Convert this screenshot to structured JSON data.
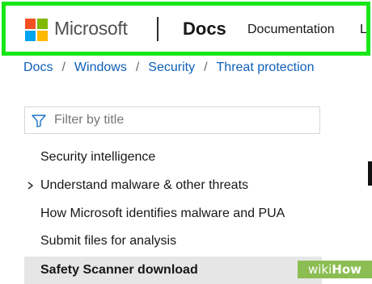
{
  "header": {
    "brand": "Microsoft",
    "logo_colors": [
      "#f25022",
      "#7fba00",
      "#00a4ef",
      "#ffb900"
    ],
    "site": "Docs",
    "nav": [
      {
        "label": "Documentation"
      },
      {
        "label": "Le"
      }
    ],
    "highlight_color": "#19e619"
  },
  "breadcrumb": [
    {
      "label": "Docs"
    },
    {
      "label": "Windows"
    },
    {
      "label": "Security"
    },
    {
      "label": "Threat protection"
    }
  ],
  "filter": {
    "placeholder": "Filter by title",
    "value": "",
    "icon": "filter-icon"
  },
  "toc": [
    {
      "label": "Security intelligence",
      "expandable": false,
      "selected": false
    },
    {
      "label": "Understand malware & other threats",
      "expandable": true,
      "selected": false
    },
    {
      "label": "How Microsoft identifies malware and PUA",
      "expandable": false,
      "selected": false
    },
    {
      "label": "Submit files for analysis",
      "expandable": false,
      "selected": false
    },
    {
      "label": "Safety Scanner download",
      "expandable": false,
      "selected": true
    }
  ],
  "watermark": {
    "part1": "wiki",
    "part2": "How"
  }
}
